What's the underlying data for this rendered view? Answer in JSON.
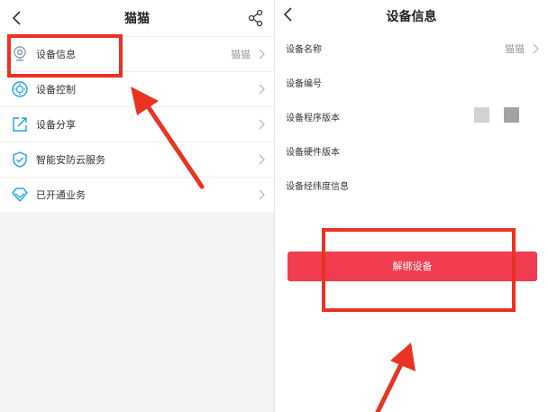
{
  "left": {
    "title": "猫猫",
    "items": [
      {
        "label": "设备信息",
        "value": "猫猫"
      },
      {
        "label": "设备控制"
      },
      {
        "label": "设备分享"
      },
      {
        "label": "智能安防云服务"
      },
      {
        "label": "已开通业务"
      }
    ]
  },
  "right": {
    "title": "设备信息",
    "rows": [
      {
        "label": "设备名称",
        "value": "猫猫"
      },
      {
        "label": "设备编号"
      },
      {
        "label": "设备程序版本"
      },
      {
        "label": "设备硬件版本"
      },
      {
        "label": "设备经纬度信息"
      }
    ],
    "unbind_label": "解绑设备"
  },
  "colors": {
    "accent": "#1aa3e8",
    "button_red": "#f23c4f",
    "annotation_red": "#e93323"
  },
  "icons": [
    "back-icon",
    "share-icon",
    "camera-icon",
    "control-icon",
    "share-box-icon",
    "shield-check-icon",
    "diamond-icon",
    "chevron-right-icon"
  ]
}
